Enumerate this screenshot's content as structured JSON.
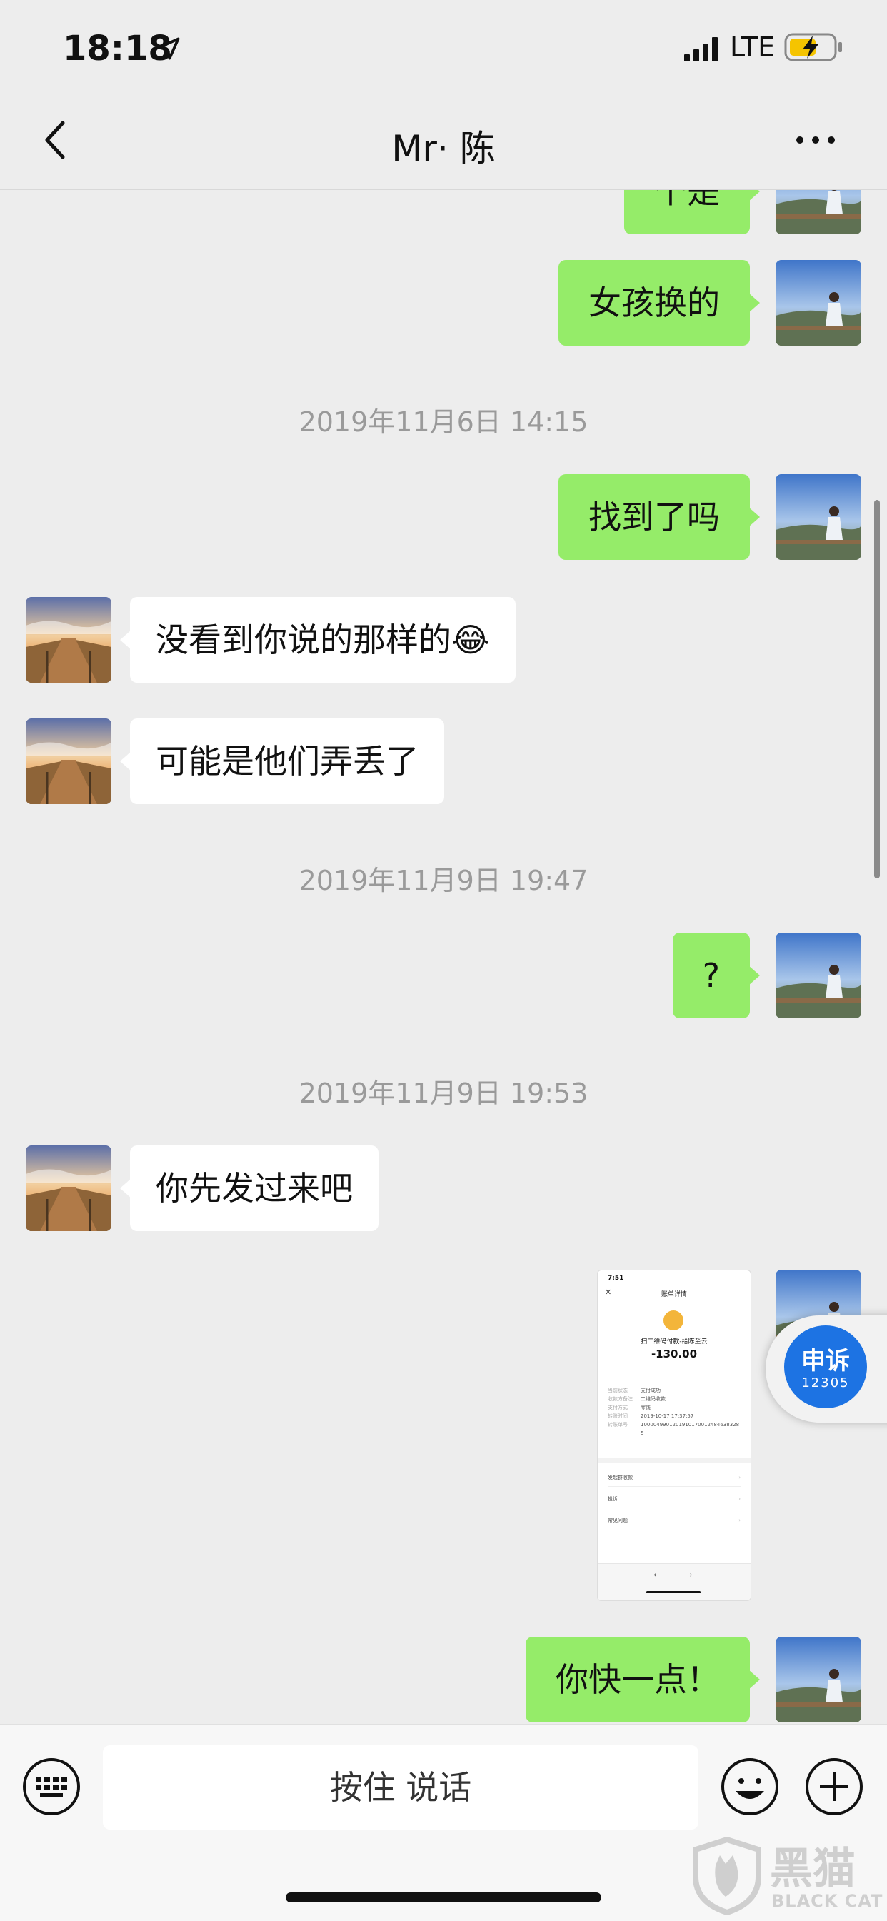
{
  "status_bar": {
    "time": "18:18",
    "carrier": "LTE"
  },
  "nav": {
    "title": "Mr· 陈"
  },
  "messages": {
    "m0_partial": "个是",
    "m1": "女孩换的",
    "ts1": "2019年11月6日 14:15",
    "m2": "找到了吗",
    "m3": "没看到你说的那样的😂",
    "m4": "可能是他们弄丢了",
    "ts2": "2019年11月9日 19:47",
    "m5": "?",
    "ts3": "2019年11月9日 19:53",
    "m6": "你先发过来吧",
    "m8": "你快一点！"
  },
  "screenshot_thumb": {
    "time": "7:51",
    "header": "账单详情",
    "merchant": "扫二维码付款-给陈至云",
    "amount": "-130.00",
    "rows": [
      {
        "k": "当前状态",
        "v": "支付成功"
      },
      {
        "k": "收款方备注",
        "v": "二维码收款"
      },
      {
        "k": "支付方式",
        "v": "零钱"
      },
      {
        "k": "转账时间",
        "v": "2019-10-17 17:37:57"
      },
      {
        "k": "转账单号",
        "v": "10000499012019101700124846383285"
      }
    ],
    "links": [
      "发起群收款",
      "投诉",
      "常见问题"
    ]
  },
  "floating_button": {
    "line1": "申诉",
    "line2": "12305"
  },
  "input_bar": {
    "talk_label": "按住 说话"
  },
  "watermark": {
    "cn": "黑猫",
    "en": "BLACK CAT"
  },
  "colors": {
    "my_bubble": "#95ec69",
    "their_bubble": "#ffffff",
    "background": "#ededed",
    "appeal_blue": "#1d73e3"
  }
}
